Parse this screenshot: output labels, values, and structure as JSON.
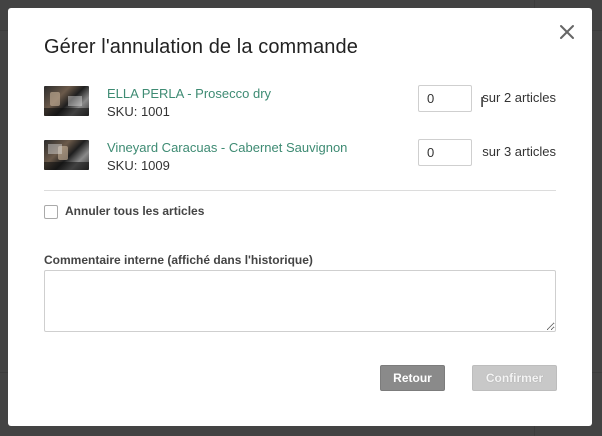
{
  "modal": {
    "title": "Gérer l'annulation de la commande",
    "close_icon": "close-icon",
    "items": [
      {
        "name": "ELLA PERLA - Prosecco dry",
        "sku": "SKU: 1001",
        "qty_value": "0",
        "qty_suffix": "sur 2 articles"
      },
      {
        "name": "Vineyard Caracuas - Cabernet Sauvignon",
        "sku": "SKU: 1009",
        "qty_value": "0",
        "qty_suffix": "sur 3 articles"
      }
    ],
    "cancel_all_label": "Annuler tous les articles",
    "comment_label": "Commentaire interne (affiché dans l'historique)",
    "comment_value": "",
    "back_label": "Retour",
    "confirm_label": "Confirmer"
  },
  "colors": {
    "link": "#3e8b73",
    "back_button": "#8a8a8a",
    "confirm_button_disabled": "#c8c8c8"
  }
}
